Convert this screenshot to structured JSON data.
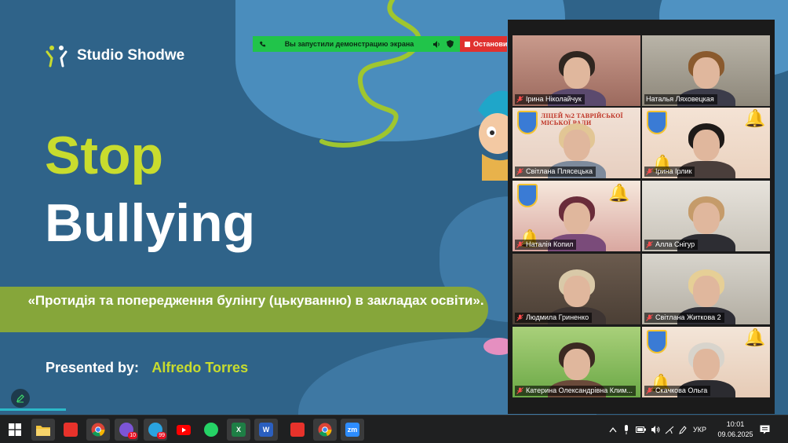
{
  "slide": {
    "brand": "Studio Shodwe",
    "title_line1": "Stop",
    "title_line2": "Bullying",
    "subtitle": "«Протидія та попередження булінгу (цькуванню) в закладах освіти».",
    "presented_label": "Presented by:",
    "presenter": "Alfredo Torres"
  },
  "share_bar": {
    "message": "Вы запустили демонстрацию экрана",
    "stop_label": "Остановить"
  },
  "gallery": {
    "school_caption": "ЛІЦЕЙ №2 ТАВРІЙСЬКОЇ МІСЬКОЇ РАДИ",
    "participants": [
      {
        "name": "Ірина Ніколайчук",
        "muted": true,
        "active": true
      },
      {
        "name": "Наталья Ляховецкая",
        "muted": false
      },
      {
        "name": "Світлана Плясецька",
        "muted": true
      },
      {
        "name": "Ірина Ірлик",
        "muted": true
      },
      {
        "name": "Наталія Копил",
        "muted": true
      },
      {
        "name": "Алла Снігур",
        "muted": true
      },
      {
        "name": "Людмила Гриненко",
        "muted": true
      },
      {
        "name": "Світлана Житкова 2",
        "muted": true
      },
      {
        "name": "Катерина Олександрівна Клим...",
        "muted": true
      },
      {
        "name": "Скачкова Ольга",
        "muted": true
      }
    ]
  },
  "taskbar": {
    "apps": [
      {
        "name": "start-button",
        "label": ""
      },
      {
        "name": "file-explorer",
        "label": ""
      },
      {
        "name": "acrobat-app",
        "label": ""
      },
      {
        "name": "chrome-app",
        "label": ""
      },
      {
        "name": "viber-app",
        "label": "",
        "badge": "10"
      },
      {
        "name": "telegram-app",
        "label": "",
        "badge": "99"
      },
      {
        "name": "youtube-app",
        "label": ""
      },
      {
        "name": "whatsapp-app",
        "label": ""
      },
      {
        "name": "excel-app",
        "label": "X"
      },
      {
        "name": "word-app",
        "label": "W"
      },
      {
        "name": "pdf-app",
        "label": ""
      },
      {
        "name": "chrome-app-2",
        "label": ""
      },
      {
        "name": "zoom-app",
        "label": "zm"
      }
    ],
    "language": "УКР",
    "time": "10:01",
    "date": "09.06.2025"
  },
  "colors": {
    "slide_bg": "#2f6389",
    "accent_lime": "#c8dc2e",
    "subtitle_bar": "#86a63a",
    "share_green": "#21c44a",
    "share_red": "#e0312f",
    "active_speaker": "#3ddc6b"
  }
}
